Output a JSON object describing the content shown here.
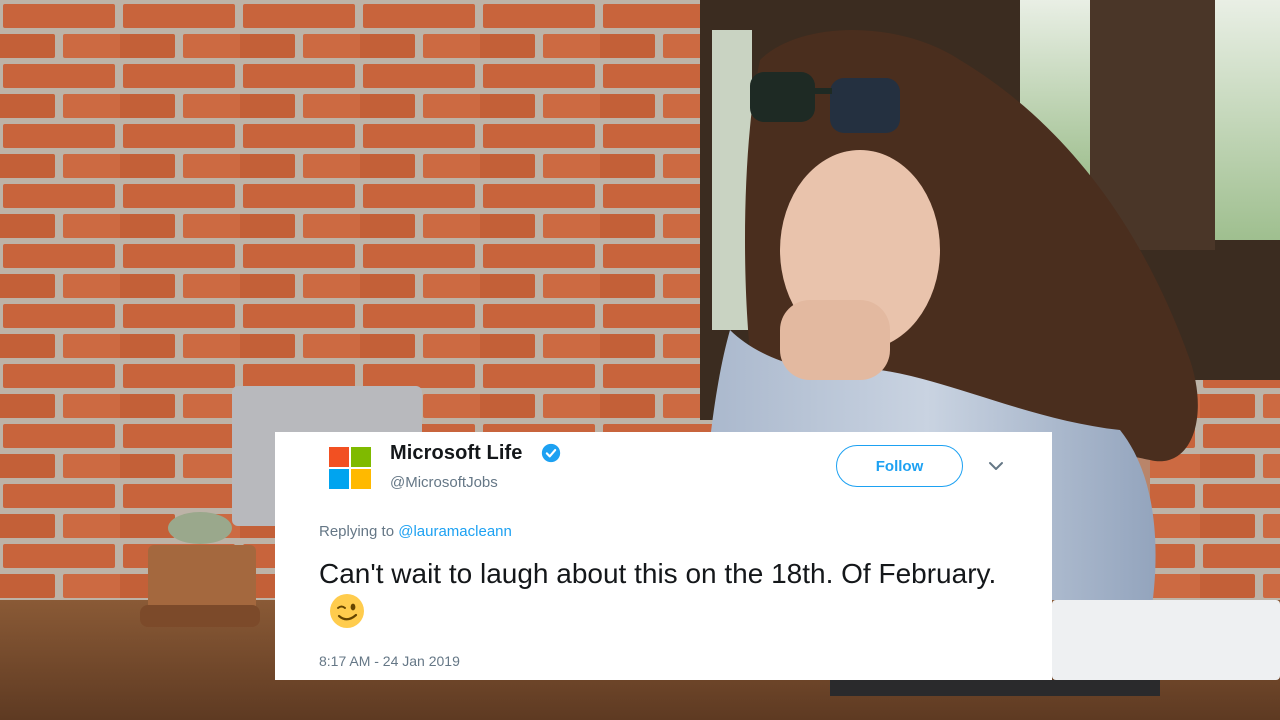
{
  "tweet": {
    "author_name": "Microsoft Life",
    "author_handle": "@MicrosoftJobs",
    "follow_label": "Follow",
    "replying_prefix": "Replying to",
    "replying_to": "@lauramacleann",
    "text": "Can't wait to laugh about this on the 18th. Of February.",
    "emoji": "winking-face",
    "timestamp": "8:17 AM - 24 Jan 2019"
  },
  "icons": {
    "logo": "microsoft-logo",
    "verified": "verified-badge-icon",
    "menu": "chevron-down-icon"
  },
  "colors": {
    "twitter_blue": "#1da1f2",
    "text_primary": "#14171a",
    "text_secondary": "#657786",
    "ms_red": "#f25022",
    "ms_green": "#7fba00",
    "ms_blue": "#00a4ef",
    "ms_yellow": "#ffb900"
  }
}
